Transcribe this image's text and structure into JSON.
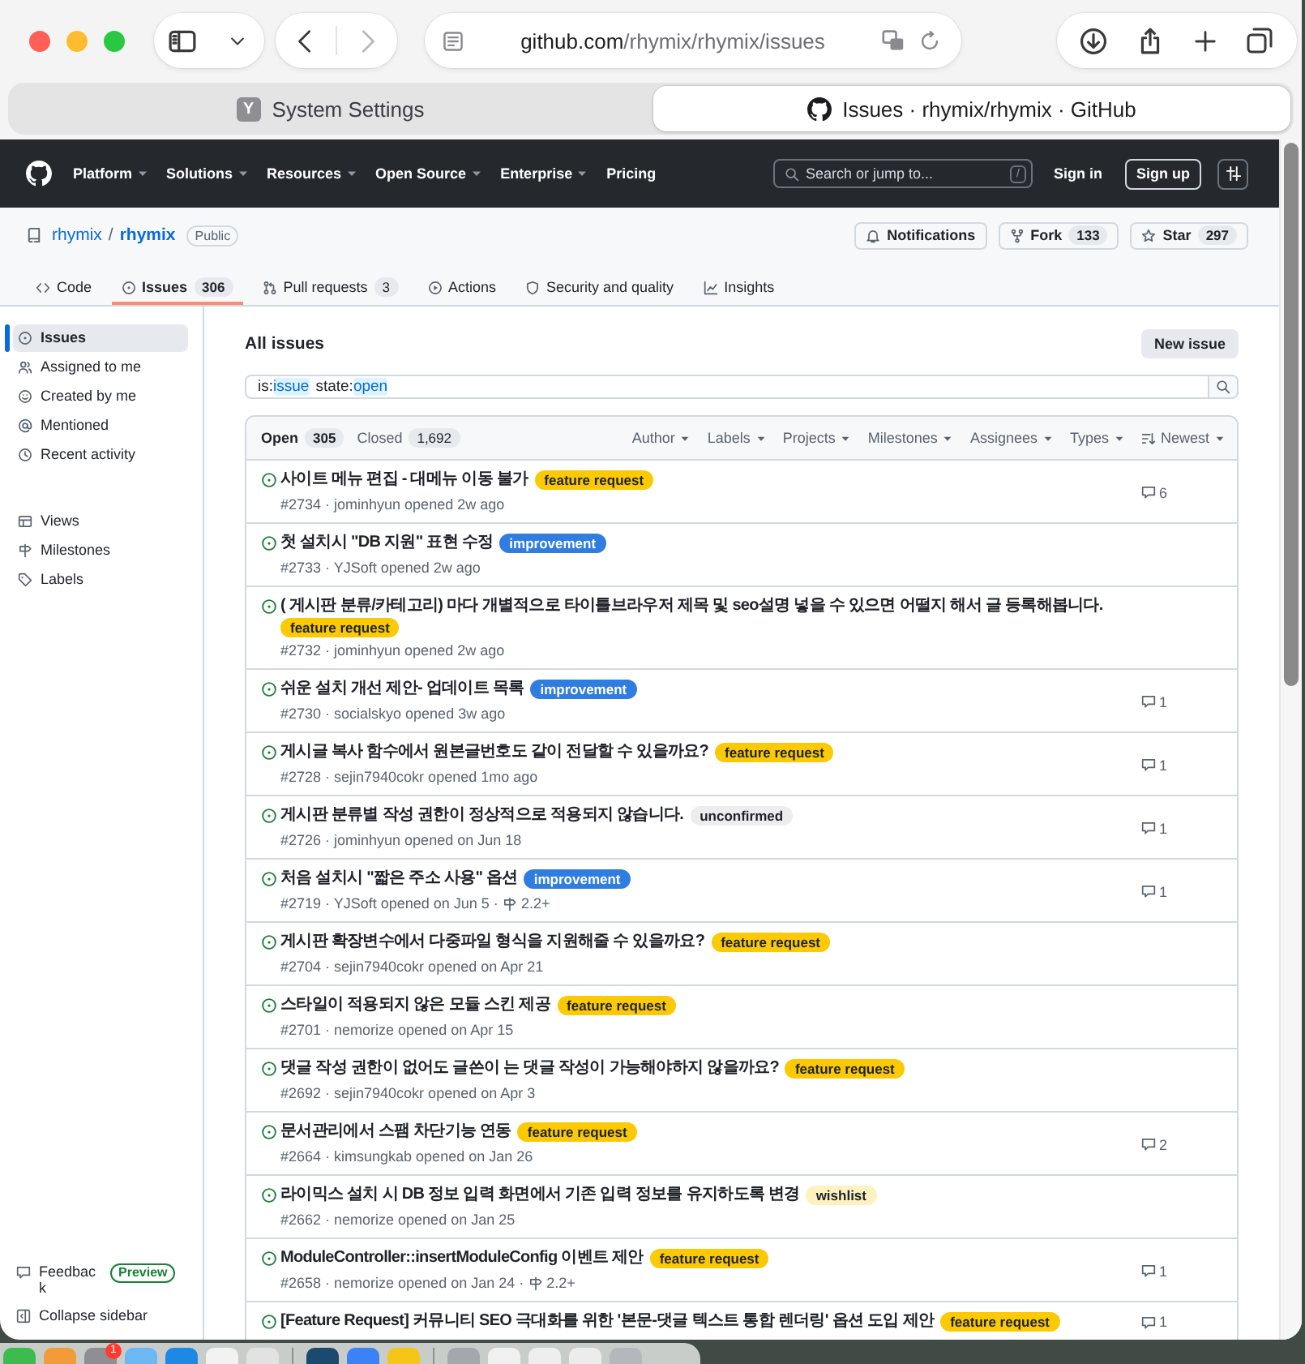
{
  "browser": {
    "history": [
      {
        "kind": "back",
        "disabled": false
      },
      {
        "kind": "forward",
        "disabled": true
      }
    ],
    "url": {
      "host": "github.com",
      "path": "/rhymix/rhymix/issues"
    },
    "tabs": [
      {
        "title": "System Settings",
        "favicon_letter": "Y",
        "selected": false
      },
      {
        "title": "Issues · rhymix/rhymix · GitHub",
        "selected": true
      }
    ]
  },
  "header": {
    "nav": [
      {
        "label": "Platform",
        "dropdown": true
      },
      {
        "label": "Solutions",
        "dropdown": true
      },
      {
        "label": "Resources",
        "dropdown": true
      },
      {
        "label": "Open Source",
        "dropdown": true
      },
      {
        "label": "Enterprise",
        "dropdown": true
      },
      {
        "label": "Pricing",
        "dropdown": false
      }
    ],
    "search": {
      "placeholder": "Search or jump to...",
      "shortcut": "/"
    },
    "sign_in": "Sign in",
    "sign_up": "Sign up"
  },
  "repo": {
    "owner": "rhymix",
    "separator": "/",
    "name": "rhymix",
    "visibility": "Public",
    "actions": [
      {
        "kind": "notifications",
        "label": "Notifications"
      },
      {
        "kind": "fork",
        "label": "Fork",
        "count": "133"
      },
      {
        "kind": "star",
        "label": "Star",
        "count": "297"
      }
    ],
    "tabs": [
      {
        "kind": "code",
        "label": "Code",
        "selected": false
      },
      {
        "kind": "issues",
        "label": "Issues",
        "count": "306",
        "selected": true
      },
      {
        "kind": "pulls",
        "label": "Pull requests",
        "count": "3",
        "selected": false
      },
      {
        "kind": "actions",
        "label": "Actions",
        "selected": false
      },
      {
        "kind": "security",
        "label": "Security and quality",
        "selected": false
      },
      {
        "kind": "insights",
        "label": "Insights",
        "selected": false
      }
    ]
  },
  "sidebar": {
    "items": [
      {
        "kind": "issues",
        "label": "Issues",
        "selected": true
      },
      {
        "kind": "assigned",
        "label": "Assigned to me",
        "selected": false
      },
      {
        "kind": "created",
        "label": "Created by me",
        "selected": false
      },
      {
        "kind": "mentioned",
        "label": "Mentioned",
        "selected": false
      },
      {
        "kind": "recent",
        "label": "Recent activity",
        "selected": false
      }
    ],
    "views": [
      {
        "kind": "views",
        "label": "Views",
        "selected": false
      },
      {
        "kind": "milestones",
        "label": "Milestones",
        "selected": false
      },
      {
        "kind": "labels",
        "label": "Labels",
        "selected": false
      }
    ],
    "feedback": {
      "label": "Feedback",
      "badge": "Preview"
    },
    "collapse": "Collapse sidebar"
  },
  "main": {
    "title": "All issues",
    "new_issue": "New issue",
    "query": [
      {
        "key": "is:",
        "value": "issue"
      },
      {
        "key": "state:",
        "value": "open"
      }
    ],
    "states": [
      {
        "label": "Open",
        "count": "305",
        "selected": true
      },
      {
        "label": "Closed",
        "count": "1,692",
        "selected": false
      }
    ],
    "filters": [
      {
        "kind": "menu",
        "label": "Author"
      },
      {
        "kind": "menu",
        "label": "Labels"
      },
      {
        "kind": "menu",
        "label": "Projects"
      },
      {
        "kind": "menu",
        "label": "Milestones"
      },
      {
        "kind": "menu",
        "label": "Assignees"
      },
      {
        "kind": "menu",
        "label": "Types"
      },
      {
        "kind": "sort",
        "label": "Newest"
      }
    ],
    "issues": [
      {
        "title": "사이트 메뉴 편집 - 대메뉴 이동 불가",
        "labels": [
          {
            "name": "feature request",
            "color": "#fbca04"
          }
        ],
        "meta": "#2734 · jominhyun opened 2w ago",
        "comments": "6"
      },
      {
        "title": "첫 설치시 \"DB 지원\" 표현 수정",
        "labels": [
          {
            "name": "improvement",
            "color": "#2f7de1"
          }
        ],
        "meta": "#2733 · YJSoft opened 2w ago"
      },
      {
        "title": "( 게시판 분류/카테고리) 마다 개별적으로 타이틀브라우저 제목 및 seo설명 넣을 수 있으면 어떨지 해서 글 등록해봅니다.",
        "labels": [
          {
            "name": "feature request",
            "color": "#fbca04"
          }
        ],
        "meta": "#2732 · jominhyun opened 2w ago"
      },
      {
        "title": "쉬운 설치 개선 제안- 업데이트 목록",
        "labels": [
          {
            "name": "improvement",
            "color": "#2f7de1"
          }
        ],
        "meta": "#2730 · socialskyo opened 3w ago",
        "comments": "1"
      },
      {
        "title": "게시글 복사 함수에서 원본글번호도 같이 전달할 수 있을까요?",
        "labels": [
          {
            "name": "feature request",
            "color": "#fbca04"
          }
        ],
        "meta": "#2728 · sejin7940cokr opened 1mo ago",
        "comments": "1"
      },
      {
        "title": "게시판 분류별 작성 권한이 정상적으로 적용되지 않습니다.",
        "labels": [
          {
            "name": "unconfirmed",
            "color": "#ededed"
          }
        ],
        "meta": "#2726 · jominhyun opened on Jun 18",
        "comments": "1"
      },
      {
        "title": "처음 설치시 \"짧은 주소 사용\" 옵션",
        "labels": [
          {
            "name": "improvement",
            "color": "#2f7de1"
          }
        ],
        "meta": "#2719 · YJSoft opened on Jun 5 ·",
        "milestone": "2.2+",
        "comments": "1"
      },
      {
        "title": "게시판 확장변수에서 다중파일 형식을 지원해줄 수 있을까요?",
        "labels": [
          {
            "name": "feature request",
            "color": "#fbca04"
          }
        ],
        "meta": "#2704 · sejin7940cokr opened on Apr 21"
      },
      {
        "title": "스타일이 적용되지 않은 모듈 스킨 제공",
        "labels": [
          {
            "name": "feature request",
            "color": "#fbca04"
          }
        ],
        "meta": "#2701 · nemorize opened on Apr 15"
      },
      {
        "title": "댓글 작성 권한이 없어도 글쓴이 는 댓글 작성이 가능해야하지 않을까요?",
        "labels": [
          {
            "name": "feature request",
            "color": "#fbca04"
          }
        ],
        "meta": "#2692 · sejin7940cokr opened on Apr 3"
      },
      {
        "title": "문서관리에서 스팸 차단기능 연동",
        "labels": [
          {
            "name": "feature request",
            "color": "#fbca04"
          }
        ],
        "meta": "#2664 · kimsungkab opened on Jan 26",
        "comments": "2"
      },
      {
        "title": "라이믹스 설치 시 DB 정보 입력 화면에서 기존 입력 정보를 유지하도록 변경",
        "labels": [
          {
            "name": "wishlist",
            "color": "#fef2c0"
          }
        ],
        "meta": "#2662 · nemorize opened on Jan 25"
      },
      {
        "title": "ModuleController::insertModuleConfig 이벤트 제안",
        "labels": [
          {
            "name": "feature request",
            "color": "#fbca04"
          }
        ],
        "meta": "#2658 · nemorize opened on Jan 24 ·",
        "milestone": "2.2+",
        "comments": "1"
      },
      {
        "title": "[Feature Request] 커뮤니티 SEO 극대화를 위한 '본문-댓글 텍스트 통합 렌더링' 옵션 도입 제안",
        "labels": [
          {
            "name": "feature request",
            "color": "#fbca04"
          }
        ],
        "comments": "1"
      }
    ]
  },
  "dock": {
    "items": [
      {
        "kind": "app",
        "color": "#3dbb4f"
      },
      {
        "kind": "app",
        "color": "#f29b38"
      },
      {
        "kind": "app",
        "color": "#8e8e93",
        "badge": "1"
      },
      {
        "kind": "app",
        "color": "#6cb8f2"
      },
      {
        "kind": "app",
        "color": "#1e88e5"
      },
      {
        "kind": "app",
        "color": "#f2f2f2"
      },
      {
        "kind": "app",
        "color": "#e2e2e2"
      },
      {
        "kind": "separator"
      },
      {
        "kind": "app",
        "color": "#1c4a6e"
      },
      {
        "kind": "app",
        "color": "#3b82f6"
      },
      {
        "kind": "app",
        "color": "#f5c518"
      },
      {
        "kind": "separator"
      },
      {
        "kind": "app",
        "color": "#a3a8ad"
      },
      {
        "kind": "app",
        "color": "#f0f0f0"
      },
      {
        "kind": "app",
        "color": "#eeeeee"
      },
      {
        "kind": "app",
        "color": "#ececec"
      },
      {
        "kind": "app",
        "color": "#b4b8bc"
      }
    ]
  }
}
